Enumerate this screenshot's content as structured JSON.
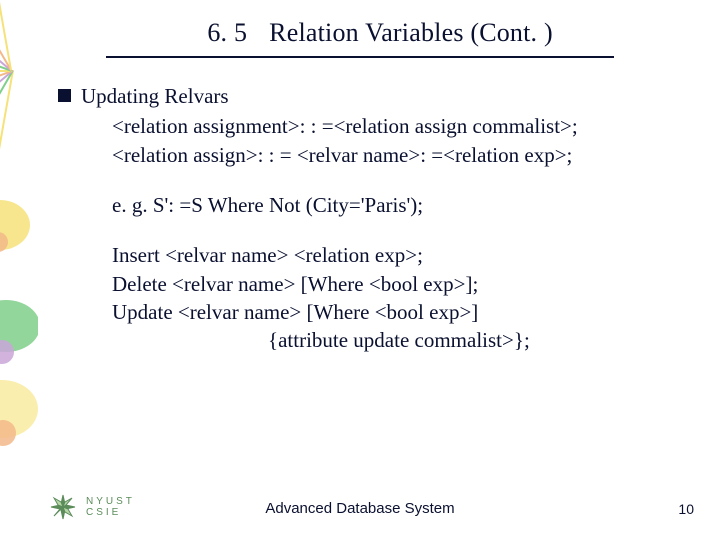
{
  "title": {
    "section": "6. 5",
    "text": "Relation Variables (Cont. )"
  },
  "bullet": {
    "heading": "Updating Relvars"
  },
  "lines": {
    "l1": "<relation assignment>: : =<relation assign commalist>;",
    "l2": "<relation assign>: : = <relvar name>: =<relation exp>;",
    "l3": "e. g. S': =S Where Not (City='Paris');",
    "l4": "Insert <relvar name> <relation exp>;",
    "l5": "Delete <relvar name> [Where <bool exp>];",
    "l6": "Update <relvar name> [Where <bool exp>]",
    "l7": "{attribute update commalist>};"
  },
  "footer": {
    "logo_top": "NYUST",
    "logo_bottom": "CSIE",
    "title": "Advanced Database System",
    "page": "10"
  }
}
